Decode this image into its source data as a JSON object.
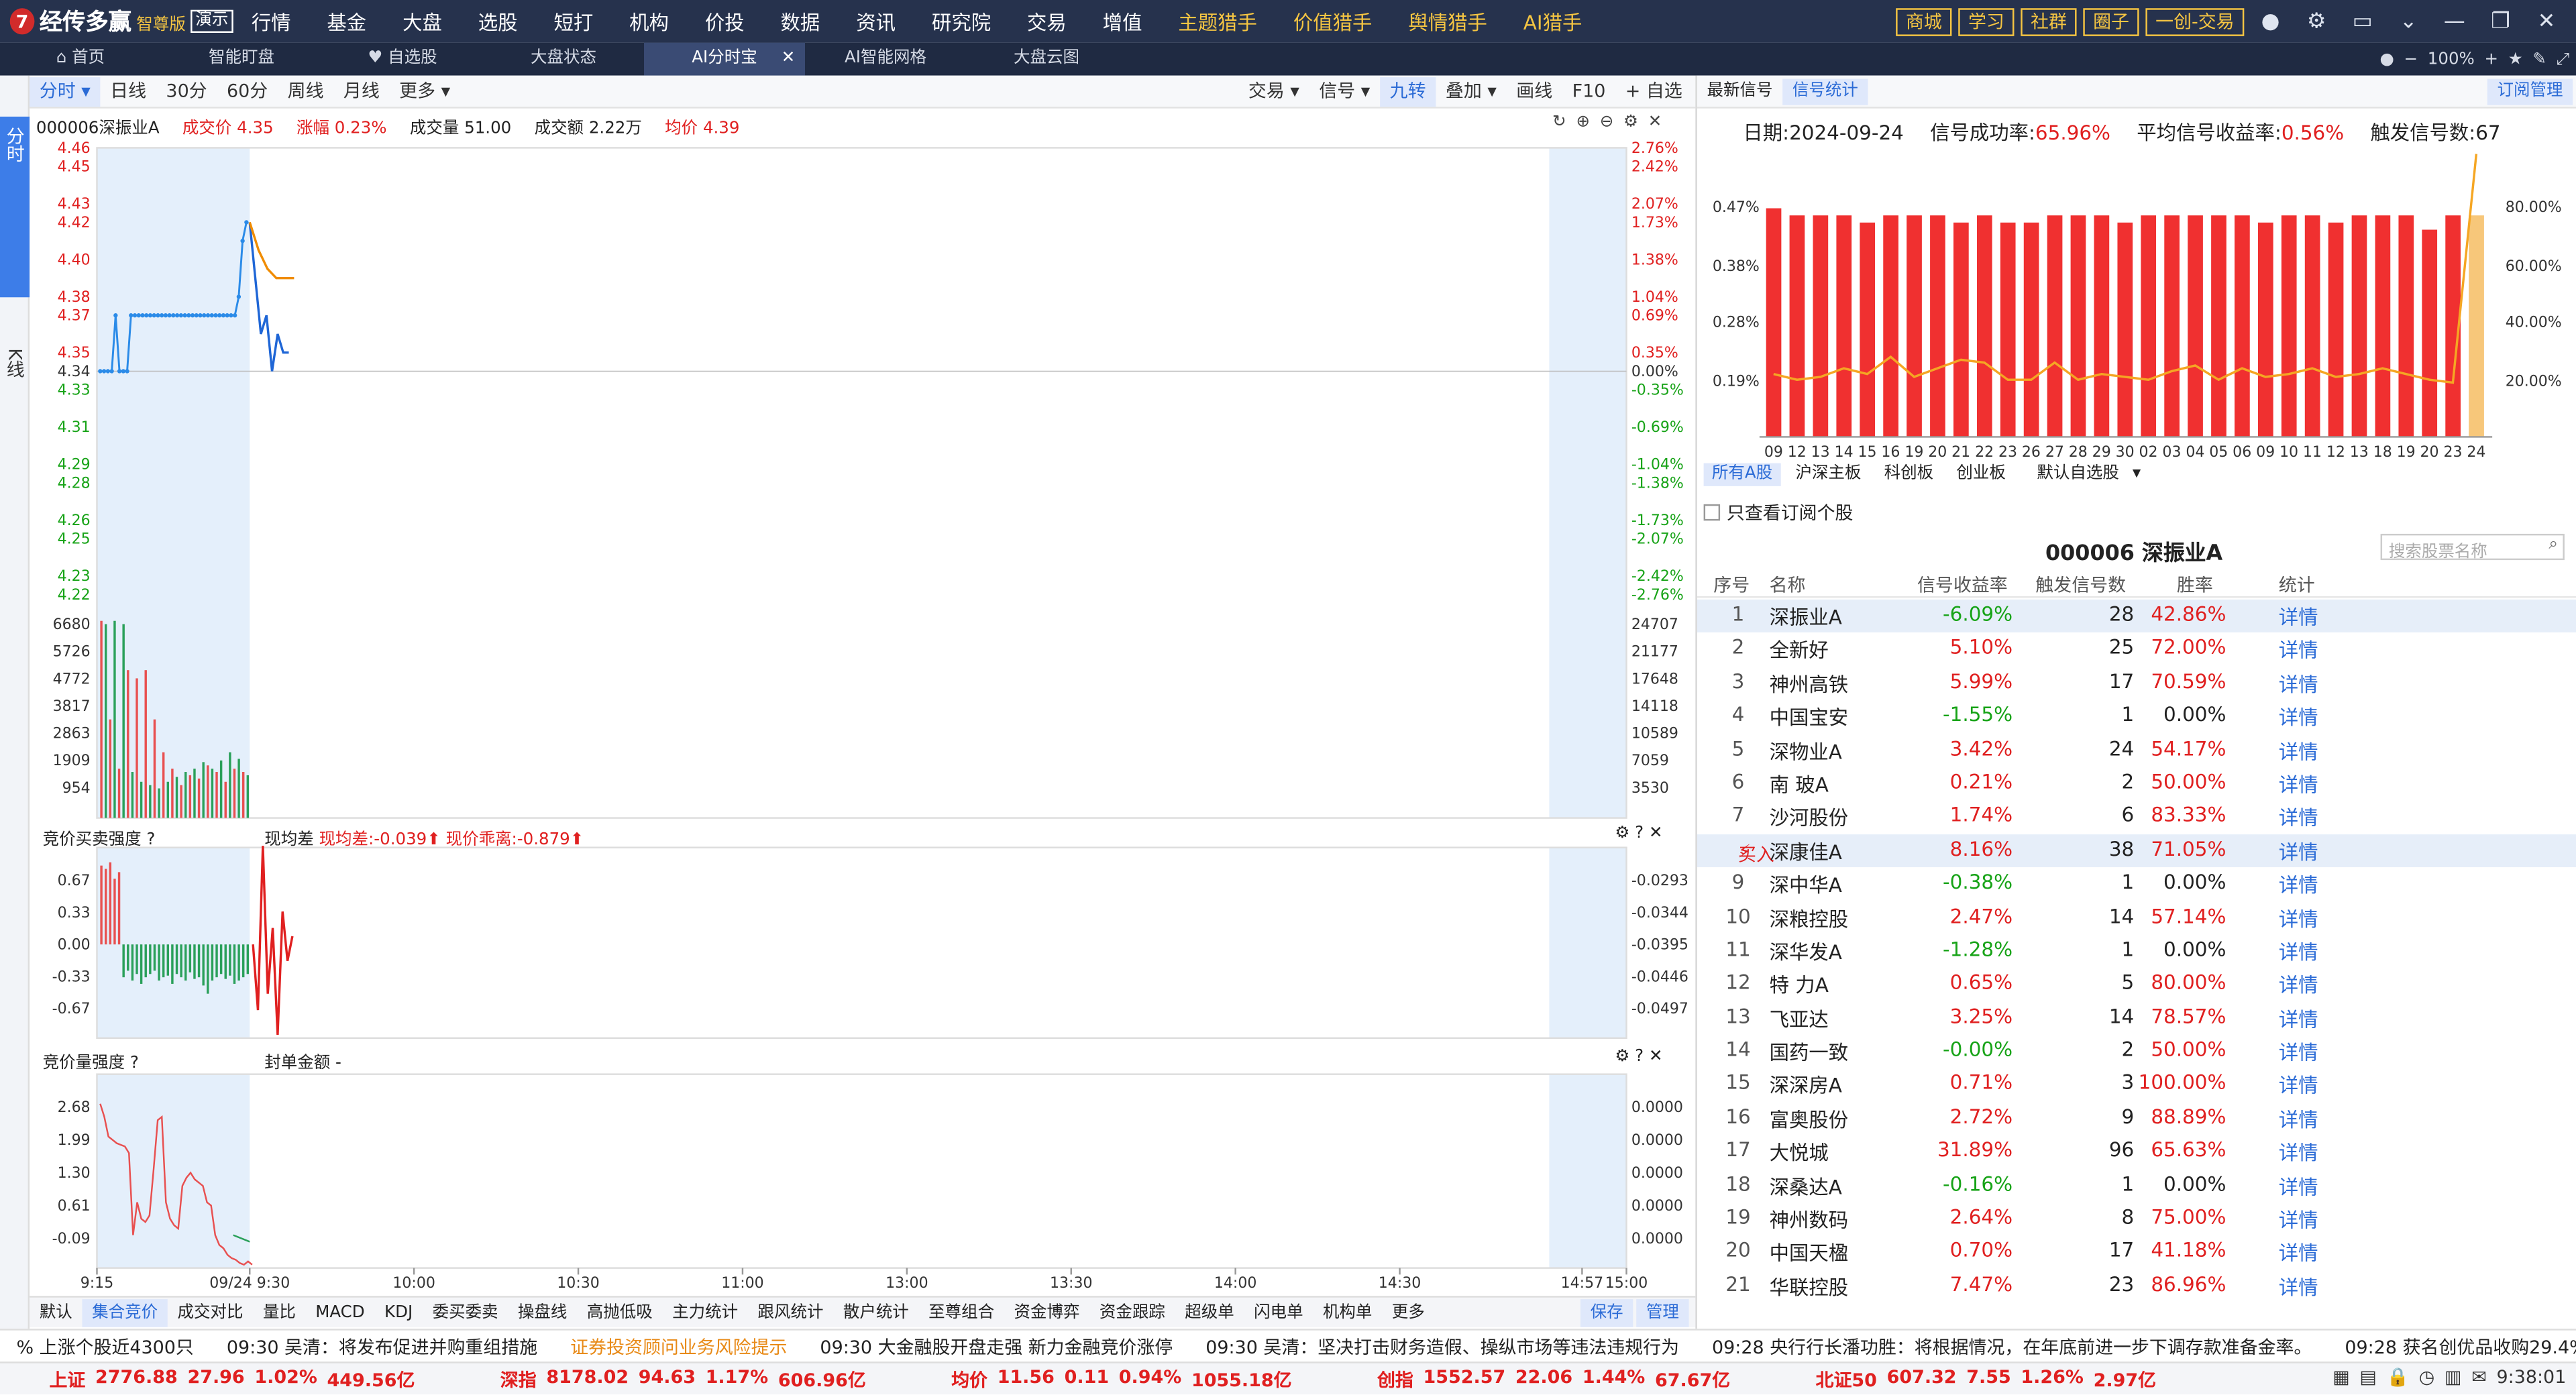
{
  "app": {
    "logo_mark": "7",
    "name": "经传多赢",
    "edition": "智尊版",
    "demo": "演示"
  },
  "nav": [
    "行情",
    "基金",
    "大盘",
    "选股",
    "短打",
    "机构",
    "价投",
    "数据",
    "资讯",
    "研究院",
    "交易",
    "增值",
    "主题猎手",
    "价值猎手",
    "舆情猎手",
    "AI猎手"
  ],
  "nav_highlight": [
    "主题猎手",
    "价值猎手",
    "舆情猎手",
    "AI猎手"
  ],
  "top_buttons": [
    "商城",
    "学习",
    "社群",
    "圈子",
    "一创-交易"
  ],
  "tabs": [
    {
      "label": "首页"
    },
    {
      "label": "智能盯盘"
    },
    {
      "label": "自选股"
    },
    {
      "label": "大盘状态"
    },
    {
      "label": "AI分时宝",
      "active": true
    },
    {
      "label": "AI智能网格"
    },
    {
      "label": "大盘云图"
    }
  ],
  "zoom": "100%",
  "rail": {
    "item1": "分时",
    "item2": "K线"
  },
  "chart_toolbar": {
    "left": [
      "分时",
      "日线",
      "30分",
      "60分",
      "周线",
      "月线",
      "更多"
    ],
    "right": [
      "交易",
      "信号",
      "九转",
      "叠加",
      "画线",
      "F10",
      "+ 自选"
    ]
  },
  "quote": {
    "code_name": "000006深振业A",
    "price_label": "成交价",
    "price": "4.35",
    "chg_label": "涨幅",
    "chg": "0.23%",
    "vol_label": "成交量",
    "vol": "51.00",
    "amt_label": "成交额",
    "amt": "2.22万",
    "avg_label": "均价",
    "avg": "4.39"
  },
  "chart_data": {
    "type": "line",
    "x_ticks": [
      "9:15",
      "09/24 9:30",
      "10:00",
      "10:30",
      "11:00",
      "13:00",
      "13:30",
      "14:00",
      "14:30",
      "14:57",
      "15:00"
    ],
    "price_axis": [
      "4.46",
      "4.45",
      "4.43",
      "4.42",
      "4.40",
      "4.38",
      "4.37",
      "4.35",
      "4.34",
      "4.33",
      "4.31",
      "4.29",
      "4.28",
      "4.26",
      "4.25",
      "4.23",
      "4.22"
    ],
    "pct_axis": [
      "2.76%",
      "2.42%",
      "2.07%",
      "1.73%",
      "1.38%",
      "1.04%",
      "0.69%",
      "0.35%",
      "0.00%",
      "-0.35%",
      "-0.69%",
      "-1.04%",
      "-1.38%",
      "-1.73%",
      "-2.07%",
      "-2.42%",
      "-2.76%"
    ],
    "prev_close": 4.34,
    "auction_price": [
      4.34,
      4.34,
      4.34,
      4.34,
      4.37,
      4.34,
      4.34,
      4.34,
      4.37,
      4.37,
      4.37,
      4.37,
      4.37,
      4.37,
      4.37,
      4.37,
      4.37,
      4.37,
      4.37,
      4.37,
      4.37,
      4.37,
      4.37,
      4.37,
      4.37,
      4.37,
      4.37,
      4.37,
      4.37,
      4.37,
      4.37,
      4.37,
      4.37,
      4.37,
      4.37,
      4.37,
      4.38,
      4.41,
      4.42
    ],
    "intraday_price": [
      4.42,
      4.39,
      4.36,
      4.37,
      4.34,
      4.36,
      4.35,
      4.35
    ],
    "avg_price": [
      4.42,
      4.405,
      4.395,
      4.39,
      4.39,
      4.39
    ],
    "vol_axis_left": [
      "6680",
      "5726",
      "4772",
      "3817",
      "2863",
      "1909",
      "954"
    ],
    "vol_axis_right": [
      "24707",
      "21177",
      "17648",
      "14118",
      "10589",
      "7059",
      "3530"
    ],
    "panel2": {
      "title": "竞价买卖强度",
      "label": "现均差",
      "val1": "现均差:-0.039",
      "val2": "现价乖离:-0.879",
      "axis_left": [
        "0.67",
        "0.33",
        "0.00",
        "-0.33",
        "-0.67"
      ],
      "axis_right": [
        "-0.0293",
        "-0.0344",
        "-0.0395",
        "-0.0446",
        "-0.0497"
      ]
    },
    "panel3": {
      "title": "竞价量强度",
      "label": "封单金额",
      "val": "-",
      "axis_left": [
        "2.68",
        "1.99",
        "1.30",
        "0.61",
        "-0.09"
      ],
      "axis_right": [
        "0.0000",
        "0.0000",
        "0.0000",
        "0.0000",
        "0.0000"
      ]
    }
  },
  "bottom_toolbar": {
    "items": [
      "默认",
      "集合竞价",
      "成交对比",
      "量比",
      "MACD",
      "KDJ",
      "委买委卖",
      "操盘线",
      "高抛低吸",
      "主力统计",
      "跟风统计",
      "散户统计",
      "至尊组合",
      "资金博弈",
      "资金跟踪",
      "超级单",
      "闪电单",
      "机构单",
      "更多"
    ],
    "right": [
      "保存",
      "管理"
    ]
  },
  "right_panel": {
    "tabs": [
      "最新信号",
      "信号统计"
    ],
    "subscribe": "订阅管理",
    "date_label": "日期:",
    "date": "2024-09-24",
    "succ_label": "信号成功率:",
    "succ": "65.96%",
    "avg_label": "平均信号收益率:",
    "avg": "0.56%",
    "cnt_label": "触发信号数:",
    "cnt": "67",
    "sig_chart": {
      "type": "bar",
      "left_axis": [
        "0.47%",
        "0.38%",
        "0.28%",
        "0.19%"
      ],
      "right_axis": [
        "80.00%",
        "60.00%",
        "40.00%",
        "20.00%"
      ],
      "categories": [
        "09",
        "12",
        "13",
        "14",
        "15",
        "16",
        "19",
        "20",
        "21",
        "22",
        "23",
        "26",
        "27",
        "28",
        "29",
        "30",
        "02",
        "03",
        "04",
        "05",
        "06",
        "09",
        "10",
        "11",
        "12",
        "13",
        "18",
        "19",
        "20",
        "23",
        "24"
      ],
      "bars": [
        0.42,
        0.41,
        0.41,
        0.41,
        0.4,
        0.41,
        0.41,
        0.41,
        0.4,
        0.41,
        0.4,
        0.4,
        0.41,
        0.41,
        0.41,
        0.4,
        0.41,
        0.41,
        0.41,
        0.41,
        0.41,
        0.4,
        0.41,
        0.41,
        0.4,
        0.41,
        0.41,
        0.41,
        0.39,
        0.41,
        0.41
      ],
      "line": [
        22,
        20,
        21,
        24,
        22,
        28,
        21,
        24,
        27,
        26,
        20,
        20,
        26,
        20,
        22,
        21,
        20,
        23,
        25,
        20,
        24,
        21,
        22,
        24,
        21,
        22,
        24,
        22,
        20,
        19,
        99
      ]
    },
    "market_tabs": [
      "所有A股",
      "沪深主板",
      "科创板",
      "创业板",
      "默认自选股"
    ],
    "check_label": "只查看订阅个股",
    "stock_title": "000006  深振业A",
    "search_placeholder": "搜索股票名称",
    "headers": [
      "序号",
      "名称",
      "信号收益率",
      "触发信号数",
      "胜率",
      "统计"
    ],
    "rows": [
      {
        "i": "1",
        "n": "深振业A",
        "r": "-6.09%",
        "c": "28",
        "w": "42.86%",
        "d": "详情"
      },
      {
        "i": "2",
        "n": "全新好",
        "r": "5.10%",
        "c": "25",
        "w": "72.00%",
        "d": "详情"
      },
      {
        "i": "3",
        "n": "神州高铁",
        "r": "5.99%",
        "c": "17",
        "w": "70.59%",
        "d": "详情"
      },
      {
        "i": "4",
        "n": "中国宝安",
        "r": "-1.55%",
        "c": "1",
        "w": "0.00%",
        "d": "详情"
      },
      {
        "i": "5",
        "n": "深物业A",
        "r": "3.42%",
        "c": "24",
        "w": "54.17%",
        "d": "详情"
      },
      {
        "i": "6",
        "n": "南 玻A",
        "r": "0.21%",
        "c": "2",
        "w": "50.00%",
        "d": "详情"
      },
      {
        "i": "7",
        "n": "沙河股份",
        "r": "1.74%",
        "c": "6",
        "w": "83.33%",
        "d": "详情"
      },
      {
        "i": "买入",
        "n": "深康佳A",
        "r": "8.16%",
        "c": "38",
        "w": "71.05%",
        "d": "详情"
      },
      {
        "i": "9",
        "n": "深中华A",
        "r": "-0.38%",
        "c": "1",
        "w": "0.00%",
        "d": "详情"
      },
      {
        "i": "10",
        "n": "深粮控股",
        "r": "2.47%",
        "c": "14",
        "w": "57.14%",
        "d": "详情"
      },
      {
        "i": "11",
        "n": "深华发A",
        "r": "-1.28%",
        "c": "1",
        "w": "0.00%",
        "d": "详情"
      },
      {
        "i": "12",
        "n": "特 力A",
        "r": "0.65%",
        "c": "5",
        "w": "80.00%",
        "d": "详情"
      },
      {
        "i": "13",
        "n": "飞亚达",
        "r": "3.25%",
        "c": "14",
        "w": "78.57%",
        "d": "详情"
      },
      {
        "i": "14",
        "n": "国药一致",
        "r": "-0.00%",
        "c": "2",
        "w": "50.00%",
        "d": "详情"
      },
      {
        "i": "15",
        "n": "深深房A",
        "r": "0.71%",
        "c": "3",
        "w": "100.00%",
        "d": "详情"
      },
      {
        "i": "16",
        "n": "富奥股份",
        "r": "2.72%",
        "c": "9",
        "w": "88.89%",
        "d": "详情"
      },
      {
        "i": "17",
        "n": "大悦城",
        "r": "31.89%",
        "c": "96",
        "w": "65.63%",
        "d": "详情"
      },
      {
        "i": "18",
        "n": "深桑达A",
        "r": "-0.16%",
        "c": "1",
        "w": "0.00%",
        "d": "详情"
      },
      {
        "i": "19",
        "n": "神州数码",
        "r": "2.64%",
        "c": "8",
        "w": "75.00%",
        "d": "详情"
      },
      {
        "i": "20",
        "n": "中国天楹",
        "r": "0.70%",
        "c": "17",
        "w": "41.18%",
        "d": "详情"
      },
      {
        "i": "21",
        "n": "华联控股",
        "r": "7.47%",
        "c": "23",
        "w": "86.96%",
        "d": "详情"
      }
    ]
  },
  "ticker": [
    "% 上涨个股近4300只",
    "09:30 吴清：将发布促进并购重组措施",
    "证券投资顾问业务风险提示",
    "09:30 大金融股开盘走强 新力金融竞价涨停",
    "09:30 吴清：坚决打击财务造假、操纵市场等违法违规行为",
    "09:28 央行行长潘功胜：将根据情况，在年底前进一步下调存款准备金率。",
    "09:28 获名创优品收购29.4%股权 永辉超市竞价涨停"
  ],
  "status": [
    {
      "name": "上证",
      "v": "2776.88",
      "c": "27.96",
      "p": "1.02%",
      "a": "449.56亿"
    },
    {
      "name": "深指",
      "v": "8178.02",
      "c": "94.63",
      "p": "1.17%",
      "a": "606.96亿"
    },
    {
      "name": "均价",
      "v": "11.56",
      "c": "0.11",
      "p": "0.94%",
      "a": "1055.18亿"
    },
    {
      "name": "创指",
      "v": "1552.57",
      "c": "22.06",
      "p": "1.44%",
      "a": "67.67亿"
    },
    {
      "name": "北证50",
      "v": "607.32",
      "c": "7.55",
      "p": "1.26%",
      "a": "2.97亿"
    }
  ],
  "clock": "9:38:01"
}
